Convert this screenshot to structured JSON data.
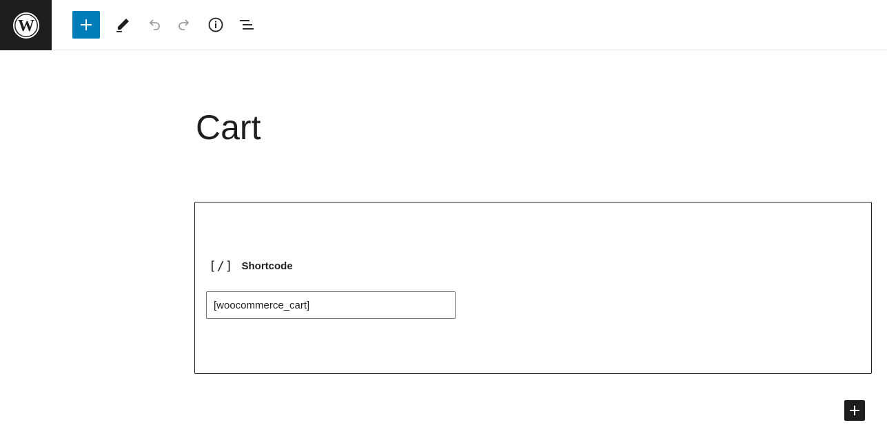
{
  "toolbar": {
    "logo_icon": "wordpress-logo-icon",
    "inserter_icon": "plus-icon",
    "tools_icon": "pencil-icon",
    "undo_icon": "undo-icon",
    "redo_icon": "redo-icon",
    "info_icon": "info-icon",
    "outline_icon": "list-view-icon",
    "accent_color": "#007cba"
  },
  "page": {
    "title": "Cart"
  },
  "shortcode_block": {
    "icon_text": "[/]",
    "label": "Shortcode",
    "value": "[woocommerce_cart]"
  },
  "appender": {
    "icon": "plus-icon"
  }
}
